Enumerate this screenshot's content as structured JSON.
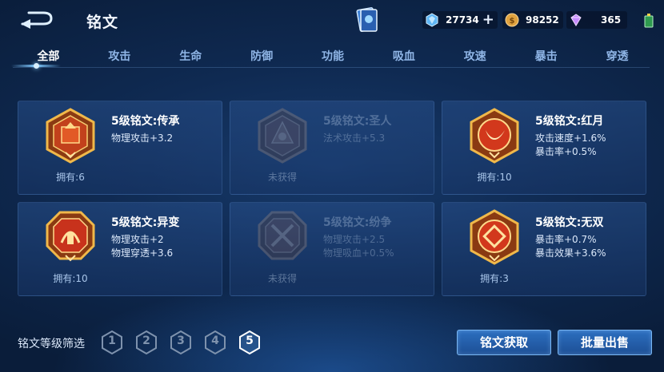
{
  "header": {
    "title": "铭文",
    "back_icon": "back-arrow-icon",
    "currencies": [
      {
        "icon": "diamond-icon",
        "value": "27734",
        "has_plus": true
      },
      {
        "icon": "gold-coin-icon",
        "value": "98252"
      },
      {
        "icon": "crystal-icon",
        "value": "365"
      }
    ]
  },
  "tabs": [
    {
      "label": "全部",
      "active": true
    },
    {
      "label": "攻击"
    },
    {
      "label": "生命"
    },
    {
      "label": "防御"
    },
    {
      "label": "功能"
    },
    {
      "label": "吸血"
    },
    {
      "label": "攻速"
    },
    {
      "label": "暴击"
    },
    {
      "label": "穿透"
    }
  ],
  "inscriptions": [
    {
      "name": "5级铭文:传承",
      "stats": [
        "物理攻击+3.2",
        ""
      ],
      "owned": "拥有:6",
      "locked": false,
      "icon": "inheritance-emblem-icon"
    },
    {
      "name": "5级铭文:圣人",
      "stats": [
        "法术攻击+5.3",
        ""
      ],
      "owned": "未获得",
      "locked": true,
      "icon": "sage-emblem-icon"
    },
    {
      "name": "5级铭文:红月",
      "stats": [
        "攻击速度+1.6%",
        "暴击率+0.5%"
      ],
      "owned": "拥有:10",
      "locked": false,
      "icon": "red-moon-emblem-icon"
    },
    {
      "name": "5级铭文:异变",
      "stats": [
        "物理攻击+2",
        "物理穿透+3.6"
      ],
      "owned": "拥有:10",
      "locked": false,
      "icon": "mutation-emblem-icon"
    },
    {
      "name": "5级铭文:纷争",
      "stats": [
        "物理攻击+2.5",
        "物理吸血+0.5%"
      ],
      "owned": "未获得",
      "locked": true,
      "icon": "strife-emblem-icon"
    },
    {
      "name": "5级铭文:无双",
      "stats": [
        "暴击率+0.7%",
        "暴击效果+3.6%"
      ],
      "owned": "拥有:3",
      "locked": false,
      "icon": "peerless-emblem-icon"
    }
  ],
  "filter": {
    "label": "铭文等级筛选",
    "levels": [
      "1",
      "2",
      "3",
      "4",
      "5"
    ],
    "selected": "5"
  },
  "actions": {
    "obtain_label": "铭文获取",
    "sell_label": "批量出售"
  },
  "colors": {
    "accent": "#7ec8ff",
    "emblem_gold": "#e8a23a",
    "emblem_red": "#c8321c"
  }
}
